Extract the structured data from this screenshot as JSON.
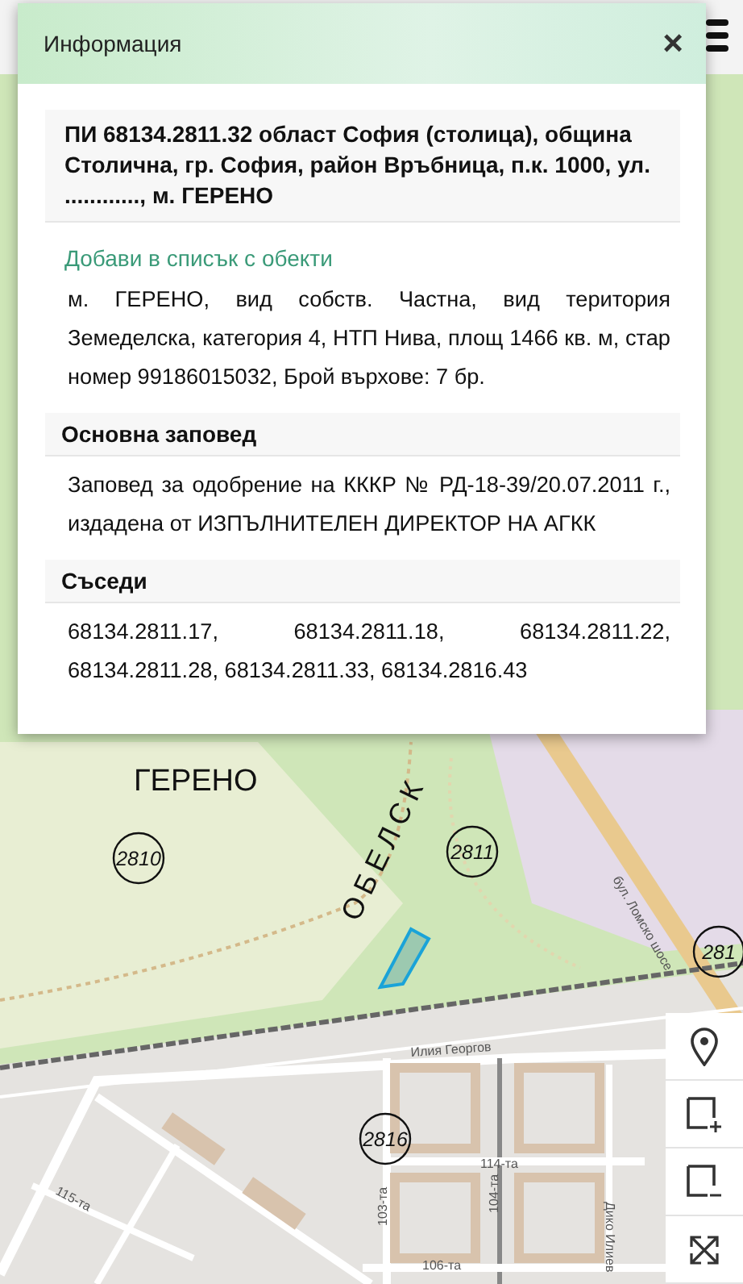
{
  "dialog": {
    "title": "Информация",
    "close": "×",
    "parcel_title": "ПИ 68134.2811.32 област София (столица), община Столична, гр. София, район Връбница, п.к. 1000, ул. ............, м. ГЕРЕНО",
    "add_link": "Добави в списък с обекти",
    "description": "м. ГЕРЕНО, вид собств. Частна, вид територия Земеделска, категория 4, НТП Нива, площ 1466 кв. м, стар номер 99186015032, Брой върхове: 7 бр.",
    "sections": [
      {
        "heading": "Основна заповед",
        "text": "Заповед за одобрение на КККР № РД-18-39/20.07.2011 г., издадена от ИЗПЪЛНИТЕЛЕН ДИРЕКТОР НА АГКК"
      },
      {
        "heading": "Съседи",
        "text": "68134.2811.17, 68134.2811.18, 68134.2811.22, 68134.2811.28, 68134.2811.33, 68134.2816.43"
      }
    ]
  },
  "map": {
    "labels": [
      {
        "kind": "area",
        "text": "ГЕРЕНО"
      },
      {
        "kind": "street",
        "text": "ОБЕЛСК"
      },
      {
        "kind": "parcel-number",
        "text": "2810"
      },
      {
        "kind": "parcel-number",
        "text": "2811"
      },
      {
        "kind": "parcel-number",
        "text": "281"
      },
      {
        "kind": "parcel-number",
        "text": "2816"
      },
      {
        "kind": "street",
        "text": "бул. Ломско шосе"
      },
      {
        "kind": "street",
        "text": "Илия Георгов"
      },
      {
        "kind": "street",
        "text": "114-та"
      },
      {
        "kind": "street",
        "text": "104-та"
      },
      {
        "kind": "street",
        "text": "103-та"
      },
      {
        "kind": "street",
        "text": "106-та"
      },
      {
        "kind": "street",
        "text": "Дико Илиев"
      },
      {
        "kind": "street",
        "text": "115-та"
      }
    ]
  }
}
